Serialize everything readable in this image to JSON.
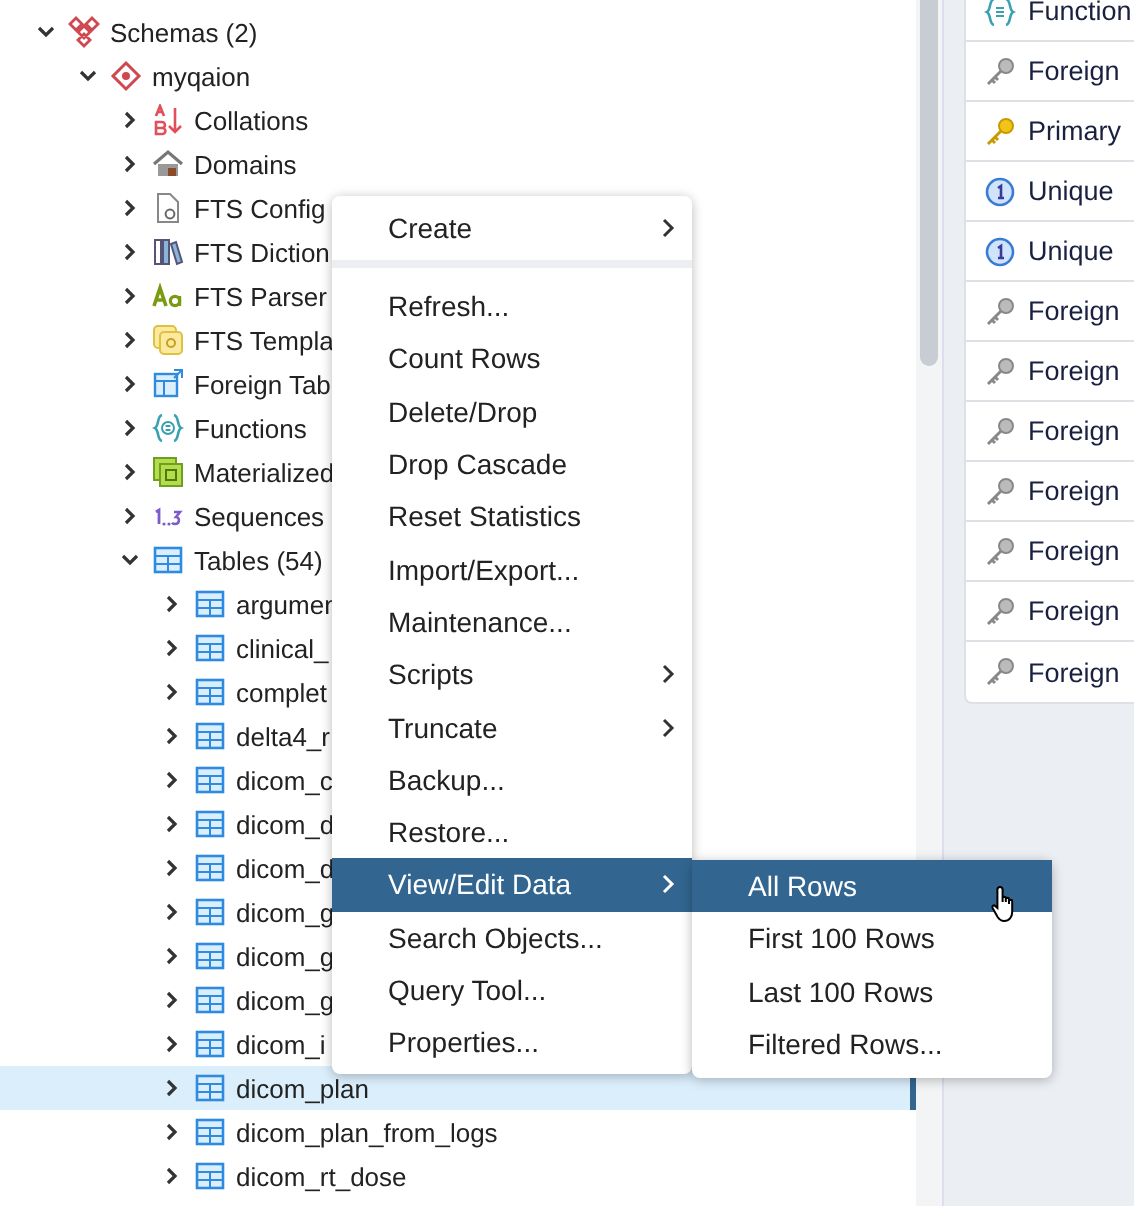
{
  "tree": [
    {
      "label": "Schemas (2)",
      "kind": "schemas",
      "expanded": true,
      "selected": false,
      "children": [
        {
          "label": "myqaion",
          "kind": "schema",
          "expanded": true,
          "selected": false,
          "children": [
            {
              "label": "Collations",
              "kind": "collation",
              "expanded": false,
              "selected": false
            },
            {
              "label": "Domains",
              "kind": "domain",
              "expanded": false,
              "selected": false
            },
            {
              "label": "FTS Config",
              "kind": "fts-config",
              "expanded": false,
              "selected": false
            },
            {
              "label": "FTS Diction",
              "kind": "fts-dict",
              "expanded": false,
              "selected": false
            },
            {
              "label": "FTS Parser",
              "kind": "fts-parser",
              "expanded": false,
              "selected": false
            },
            {
              "label": "FTS Templa",
              "kind": "fts-template",
              "expanded": false,
              "selected": false
            },
            {
              "label": "Foreign Tab",
              "kind": "foreign-table",
              "expanded": false,
              "selected": false
            },
            {
              "label": "Functions",
              "kind": "function",
              "expanded": false,
              "selected": false
            },
            {
              "label": "Materialized",
              "kind": "matview",
              "expanded": false,
              "selected": false
            },
            {
              "label": "Sequences",
              "kind": "sequence",
              "expanded": false,
              "selected": false
            },
            {
              "label": "Tables (54)",
              "kind": "table-group",
              "expanded": true,
              "selected": false,
              "children": [
                {
                  "label": "argumen",
                  "kind": "table",
                  "expanded": false,
                  "selected": false
                },
                {
                  "label": "clinical_",
                  "kind": "table",
                  "expanded": false,
                  "selected": false
                },
                {
                  "label": "complet",
                  "kind": "table",
                  "expanded": false,
                  "selected": false
                },
                {
                  "label": "delta4_r",
                  "kind": "table",
                  "expanded": false,
                  "selected": false
                },
                {
                  "label": "dicom_c",
                  "kind": "table",
                  "expanded": false,
                  "selected": false
                },
                {
                  "label": "dicom_d",
                  "kind": "table",
                  "expanded": false,
                  "selected": false
                },
                {
                  "label": "dicom_d",
                  "kind": "table",
                  "expanded": false,
                  "selected": false
                },
                {
                  "label": "dicom_g",
                  "kind": "table",
                  "expanded": false,
                  "selected": false
                },
                {
                  "label": "dicom_g",
                  "kind": "table",
                  "expanded": false,
                  "selected": false
                },
                {
                  "label": "dicom_g",
                  "kind": "table",
                  "expanded": false,
                  "selected": false
                },
                {
                  "label": "dicom_i",
                  "kind": "table",
                  "expanded": false,
                  "selected": false
                },
                {
                  "label": "dicom_plan",
                  "kind": "table",
                  "expanded": false,
                  "selected": true
                },
                {
                  "label": "dicom_plan_from_logs",
                  "kind": "table",
                  "expanded": false,
                  "selected": false
                },
                {
                  "label": "dicom_rt_dose",
                  "kind": "table",
                  "expanded": false,
                  "selected": false
                }
              ]
            }
          ]
        }
      ]
    }
  ],
  "context_menu": {
    "items": [
      {
        "label": "Create",
        "submenu": true,
        "selected": false
      },
      {
        "label": "Refresh...",
        "submenu": false,
        "selected": false
      },
      {
        "label": "Count Rows",
        "submenu": false,
        "selected": false
      },
      {
        "label": "Delete/Drop",
        "submenu": false,
        "selected": false
      },
      {
        "label": "Drop Cascade",
        "submenu": false,
        "selected": false
      },
      {
        "label": "Reset Statistics",
        "submenu": false,
        "selected": false
      },
      {
        "label": "Import/Export...",
        "submenu": false,
        "selected": false
      },
      {
        "label": "Maintenance...",
        "submenu": false,
        "selected": false
      },
      {
        "label": "Scripts",
        "submenu": true,
        "selected": false
      },
      {
        "label": "Truncate",
        "submenu": true,
        "selected": false
      },
      {
        "label": "Backup...",
        "submenu": false,
        "selected": false
      },
      {
        "label": "Restore...",
        "submenu": false,
        "selected": false
      },
      {
        "label": "View/Edit Data",
        "submenu": true,
        "selected": true
      },
      {
        "label": "Search Objects...",
        "submenu": false,
        "selected": false
      },
      {
        "label": "Query Tool...",
        "submenu": false,
        "selected": false
      },
      {
        "label": "Properties...",
        "submenu": false,
        "selected": false
      }
    ]
  },
  "submenu": {
    "items": [
      {
        "label": "All Rows",
        "selected": true
      },
      {
        "label": "First 100 Rows",
        "selected": false
      },
      {
        "label": "Last 100 Rows",
        "selected": false
      },
      {
        "label": "Filtered Rows...",
        "selected": false
      }
    ]
  },
  "dependents": [
    {
      "label": "Function",
      "kind": "function"
    },
    {
      "label": "Foreign",
      "kind": "foreign-key"
    },
    {
      "label": "Primary",
      "kind": "primary-key"
    },
    {
      "label": "Unique",
      "kind": "unique"
    },
    {
      "label": "Unique",
      "kind": "unique"
    },
    {
      "label": "Foreign",
      "kind": "foreign-key"
    },
    {
      "label": "Foreign",
      "kind": "foreign-key"
    },
    {
      "label": "Foreign",
      "kind": "foreign-key"
    },
    {
      "label": "Foreign",
      "kind": "foreign-key"
    },
    {
      "label": "Foreign",
      "kind": "foreign-key"
    },
    {
      "label": "Foreign",
      "kind": "foreign-key"
    },
    {
      "label": "Foreign",
      "kind": "foreign-key"
    }
  ]
}
